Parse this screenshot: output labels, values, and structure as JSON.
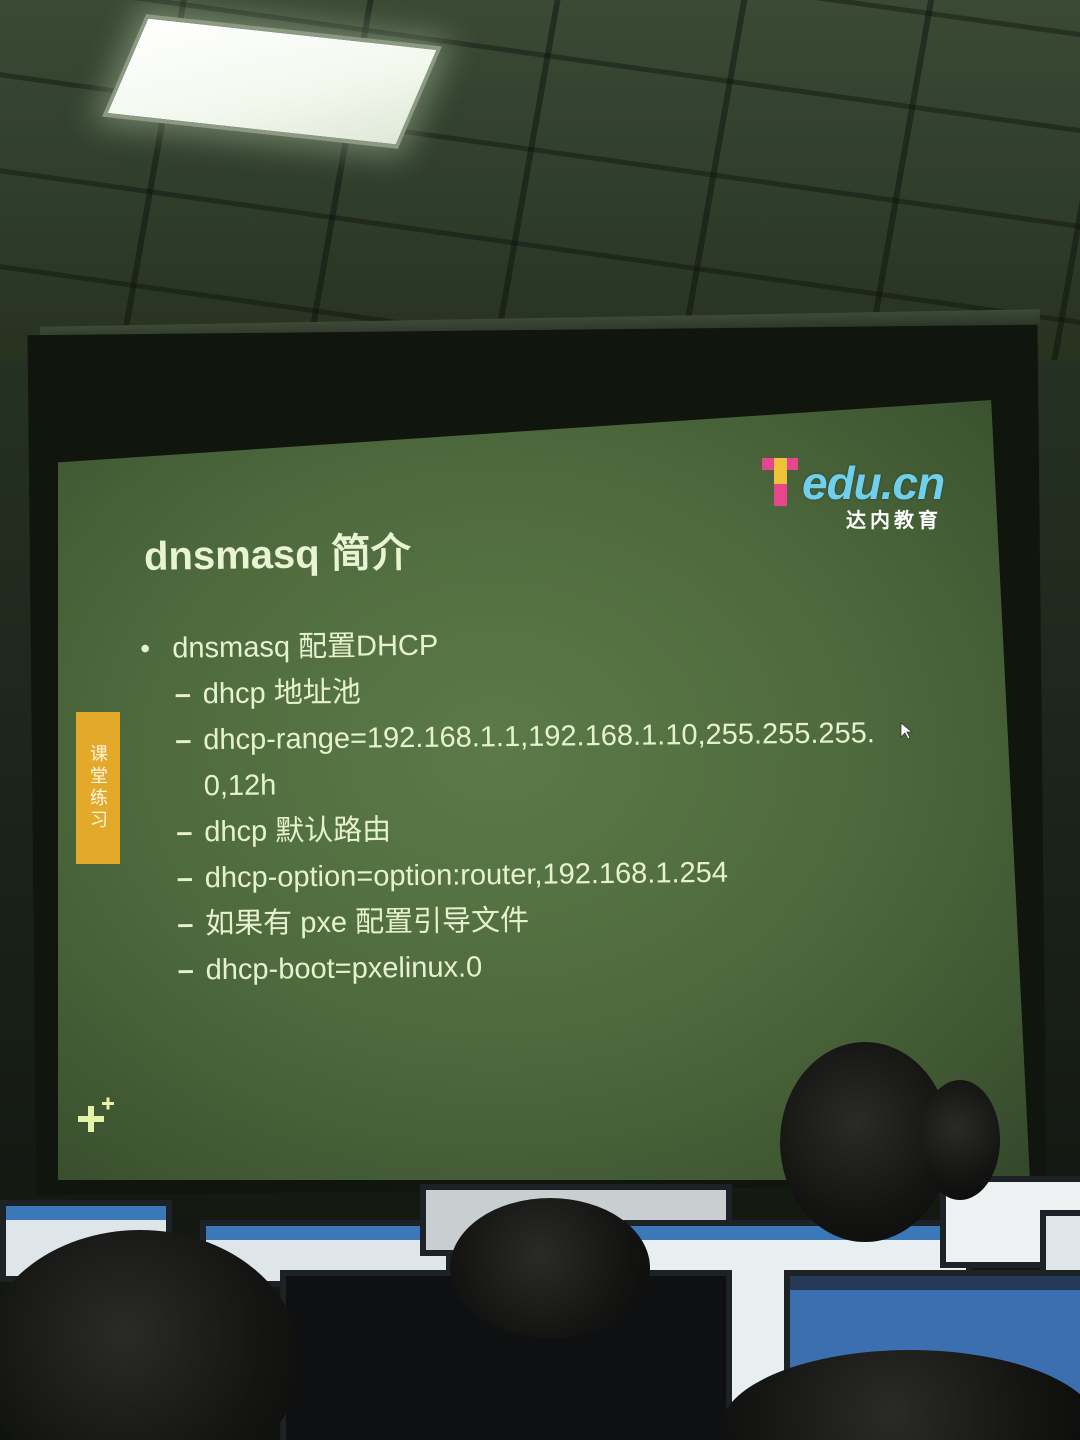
{
  "slide": {
    "logo": {
      "main": "Tedu.cn",
      "sub": "达内教育"
    },
    "title": "dnsmasq 简介",
    "side_tab": "课堂练习",
    "bullet": "dnsmasq 配置DHCP",
    "sub_items": [
      "dhcp 地址池",
      "dhcp-range=192.168.1.1,192.168.1.10,255.255.255.0,12h",
      "dhcp 默认路由",
      "dhcp-option=option:router,192.168.1.254",
      "如果有 pxe 配置引导文件",
      "dhcp-boot=pxelinux.0"
    ]
  },
  "colors": {
    "slide_background": "#4f6b3e",
    "slide_text": "#e6f2cf",
    "side_tab": "#e3a92a",
    "logo_text": "#6fd0ee"
  },
  "icons": [
    "plus-icon",
    "cursor-icon"
  ]
}
